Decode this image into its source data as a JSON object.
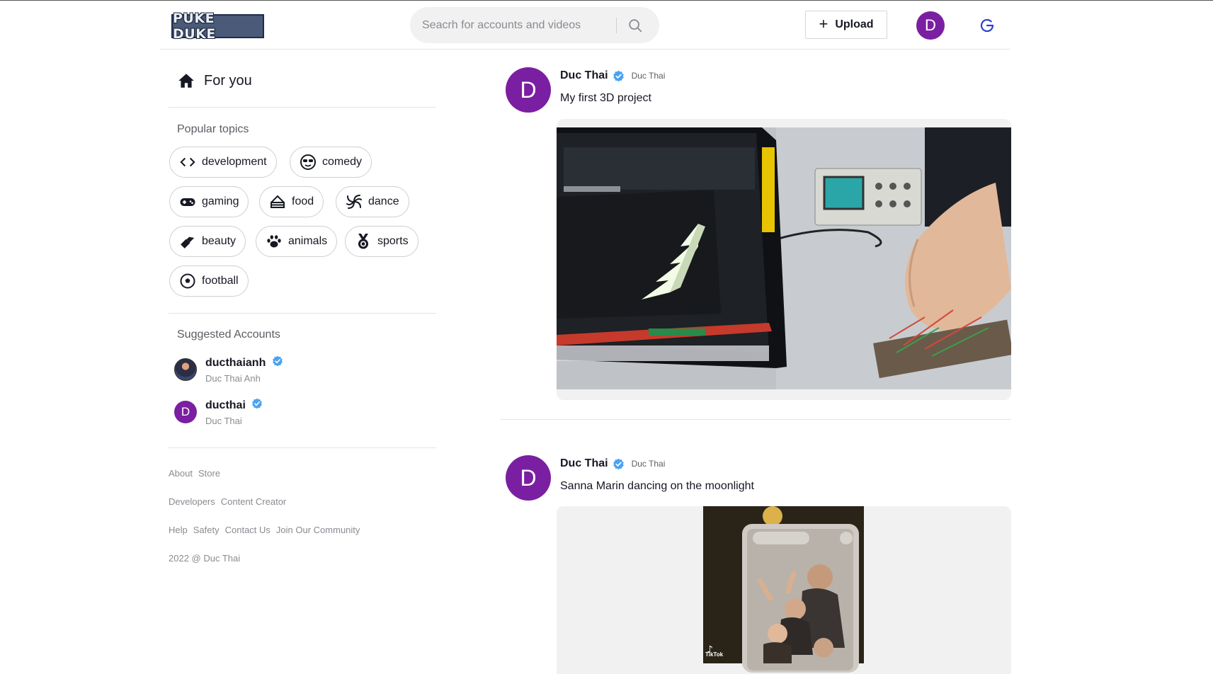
{
  "header": {
    "logo_text": "PUKE DUKE",
    "search_placeholder": "Seacrh for accounts and videos",
    "upload_label": "Upload",
    "avatar_initial": "D"
  },
  "sidebar": {
    "nav": {
      "for_you_label": "For you"
    },
    "popular_topics_title": "Popular topics",
    "topics": [
      {
        "label": "development",
        "icon": "code-icon"
      },
      {
        "label": "comedy",
        "icon": "sunglasses-face-icon"
      },
      {
        "label": "gaming",
        "icon": "gamepad-icon"
      },
      {
        "label": "food",
        "icon": "cake-icon"
      },
      {
        "label": "dance",
        "icon": "spiral-icon"
      },
      {
        "label": "beauty",
        "icon": "lipstick-icon"
      },
      {
        "label": "animals",
        "icon": "paw-icon"
      },
      {
        "label": "sports",
        "icon": "medal-icon"
      },
      {
        "label": "football",
        "icon": "soccer-ball-icon"
      }
    ],
    "suggested_title": "Suggested Accounts",
    "accounts": [
      {
        "username": "ducthaianh",
        "name": "Duc Thai Anh",
        "verified": true
      },
      {
        "username": "ducthai",
        "name": "Duc Thai",
        "verified": true,
        "initial": "D"
      }
    ],
    "footer": {
      "row1": [
        "About",
        "Store"
      ],
      "row2": [
        "Developers",
        "Content Creator"
      ],
      "row3": [
        "Help",
        "Safety",
        "Contact Us",
        "Join Our Community"
      ],
      "copyright": "2022 @ Duc Thai"
    }
  },
  "feed": {
    "posts": [
      {
        "avatar_initial": "D",
        "author": "Duc Thai",
        "nickname": "Duc Thai",
        "verified": true,
        "caption": "My first 3D project"
      },
      {
        "avatar_initial": "D",
        "author": "Duc Thai",
        "nickname": "Duc Thai",
        "verified": true,
        "caption": "Sanna Marin dancing on the moonlight",
        "watermark": "TikTok"
      }
    ]
  },
  "colors": {
    "avatar_purple": "#7b1fa2",
    "verified_blue": "#20d5ec",
    "refresh_blue": "#2f3fd1"
  }
}
